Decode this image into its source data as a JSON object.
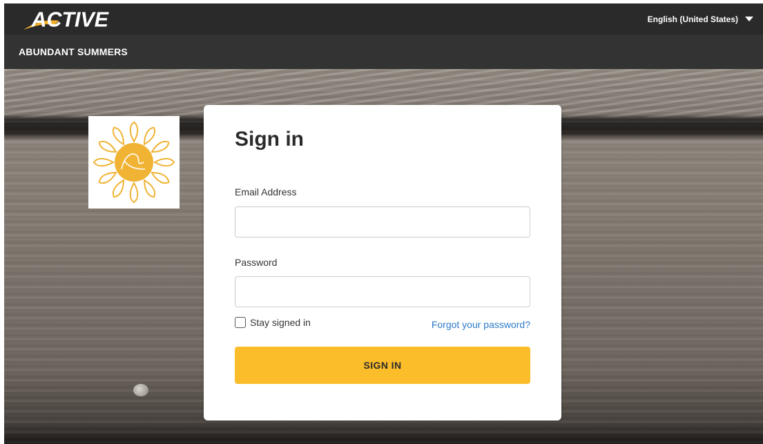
{
  "header": {
    "logo_text": "ACTIVE",
    "language": "English (United States)",
    "organization": "ABUNDANT SUMMERS"
  },
  "brand": {
    "logo_lettering": "Abundant Summers",
    "logo_color": "#f0b333"
  },
  "signin_card": {
    "title": "Sign in",
    "email_label": "Email Address",
    "email_value": "",
    "password_label": "Password",
    "password_value": "",
    "stay_signed_in_label": "Stay signed in",
    "stay_signed_in_checked": false,
    "forgot_password_link": "Forgot your password?",
    "submit_label": "SIGN IN"
  },
  "colors": {
    "topbar": "#2a2a2a",
    "subbar": "#333333",
    "accent_button": "#fcbd2a",
    "link": "#2c7ac9"
  },
  "icons": {
    "language_caret": "chevron-down-icon",
    "checkbox": "checkbox-icon"
  }
}
